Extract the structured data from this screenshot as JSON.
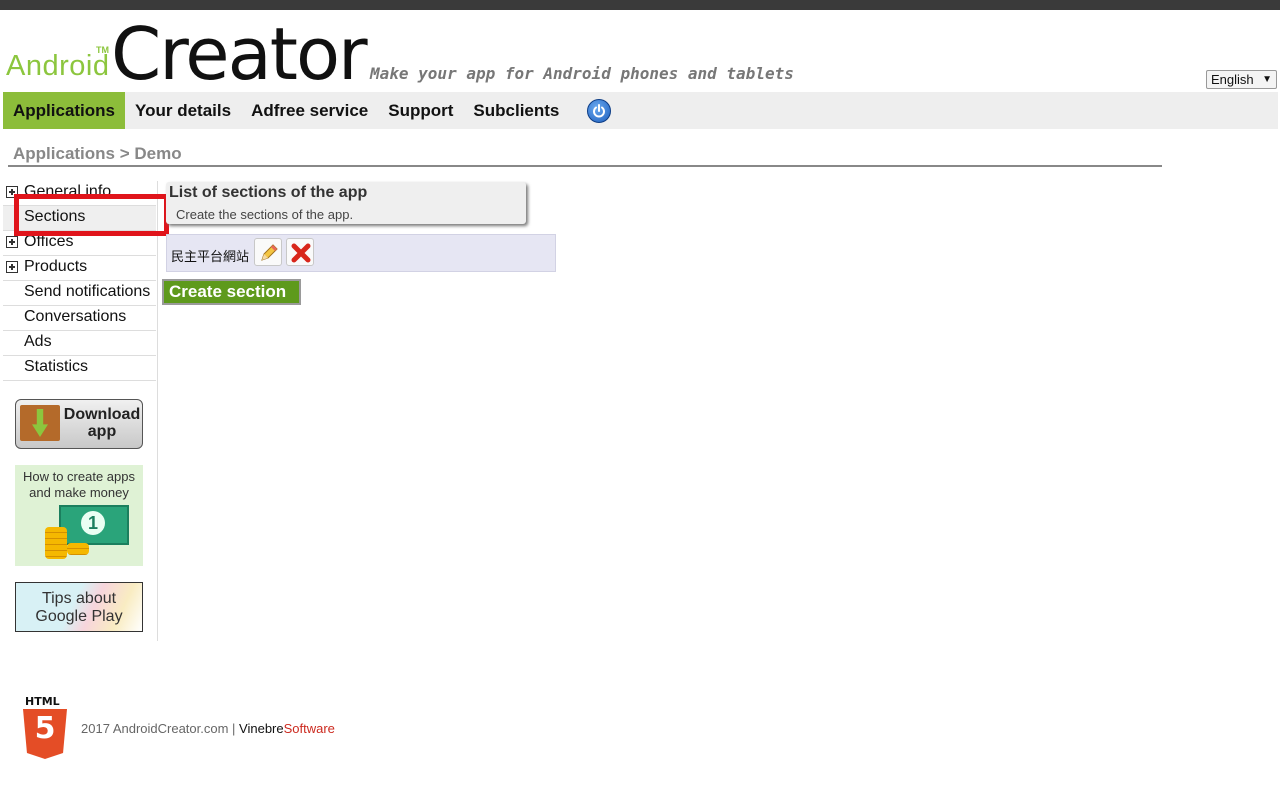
{
  "header": {
    "logo_android": "Android",
    "logo_tm": "TM",
    "logo_creator": "Creator",
    "tagline": "Make your app for Android phones and tablets",
    "language": "English",
    "brand_color": "#8cc63e"
  },
  "nav": {
    "items": [
      {
        "label": "Applications",
        "active": true
      },
      {
        "label": "Your details"
      },
      {
        "label": "Adfree service"
      },
      {
        "label": "Support"
      },
      {
        "label": "Subclients"
      }
    ],
    "power_icon": "power-icon"
  },
  "breadcrumb": "Applications > Demo",
  "sidebar": {
    "items": [
      {
        "label": "General info",
        "expandable": true
      },
      {
        "label": "Sections",
        "selected": true
      },
      {
        "label": "Offices",
        "expandable": true
      },
      {
        "label": "Products",
        "expandable": true
      },
      {
        "label": "Send notifications"
      },
      {
        "label": "Conversations"
      },
      {
        "label": "Ads"
      },
      {
        "label": "Statistics"
      }
    ],
    "download_label": "Download app",
    "howto_label": "How to create apps and make money",
    "howto_bill_number": "1",
    "tips_label": "Tips about Google Play"
  },
  "main": {
    "list_title": "List of sections of the app",
    "list_description": "Create the sections of the app.",
    "sections": [
      {
        "name": "民主平台網站"
      }
    ],
    "create_button": "Create section"
  },
  "footer": {
    "html5_label": "HTML",
    "html5_number": "5",
    "copyright": "2017 AndroidCreator.com | ",
    "vinebre": "Vinebre",
    "software": "Software"
  }
}
